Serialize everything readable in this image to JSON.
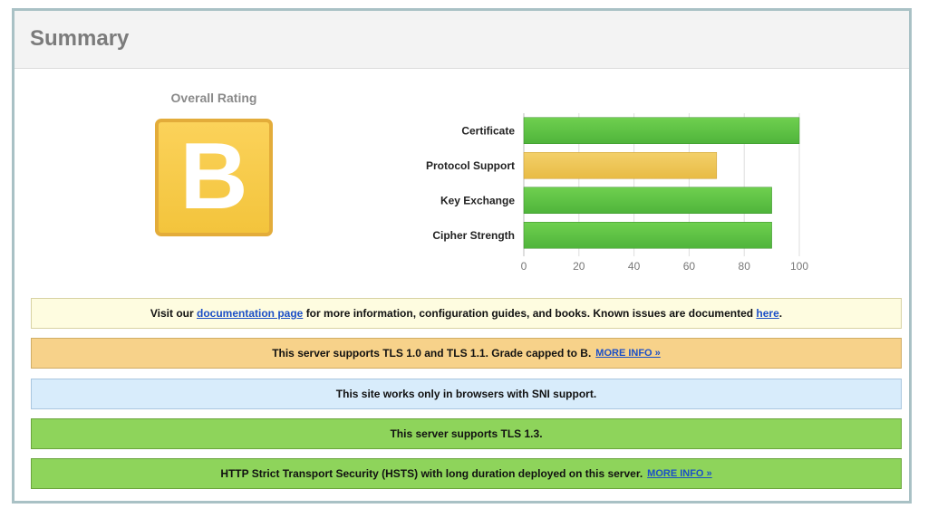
{
  "header": {
    "title": "Summary"
  },
  "rating": {
    "title": "Overall Rating",
    "grade": "B"
  },
  "colors": {
    "green_bar": "#4fb43b",
    "yellow_bar": "#e8bb45",
    "grade_fill": "#f6c843",
    "notice_yellow": "#fefce0",
    "notice_orange": "#f7d28a",
    "notice_blue": "#d8ecfb",
    "notice_green": "#8ed45b",
    "link": "#1b4fc7"
  },
  "chart_data": {
    "type": "bar",
    "orientation": "horizontal",
    "categories": [
      "Certificate",
      "Protocol Support",
      "Key Exchange",
      "Cipher Strength"
    ],
    "values": [
      100,
      70,
      90,
      90
    ],
    "bar_colors": [
      "green",
      "yellow",
      "green",
      "green"
    ],
    "xlim": [
      0,
      100
    ],
    "ticks": [
      0,
      20,
      40,
      60,
      80,
      100
    ],
    "grid": true,
    "title": "",
    "xlabel": "",
    "ylabel": ""
  },
  "notices": {
    "documentation": {
      "pre": "Visit our",
      "link1": "documentation page",
      "mid": "for more information, configuration guides, and books. Known issues are documented",
      "link2": "here",
      "post": "."
    },
    "tls_cap": {
      "text": "This server supports TLS 1.0 and TLS 1.1. Grade capped to B.",
      "link": "MORE INFO »"
    },
    "sni": {
      "text": "This site works only in browsers with SNI support."
    },
    "tls13": {
      "text": "This server supports TLS 1.3."
    },
    "hsts": {
      "text": "HTTP Strict Transport Security (HSTS) with long duration deployed on this server.",
      "link": "MORE INFO »"
    }
  }
}
